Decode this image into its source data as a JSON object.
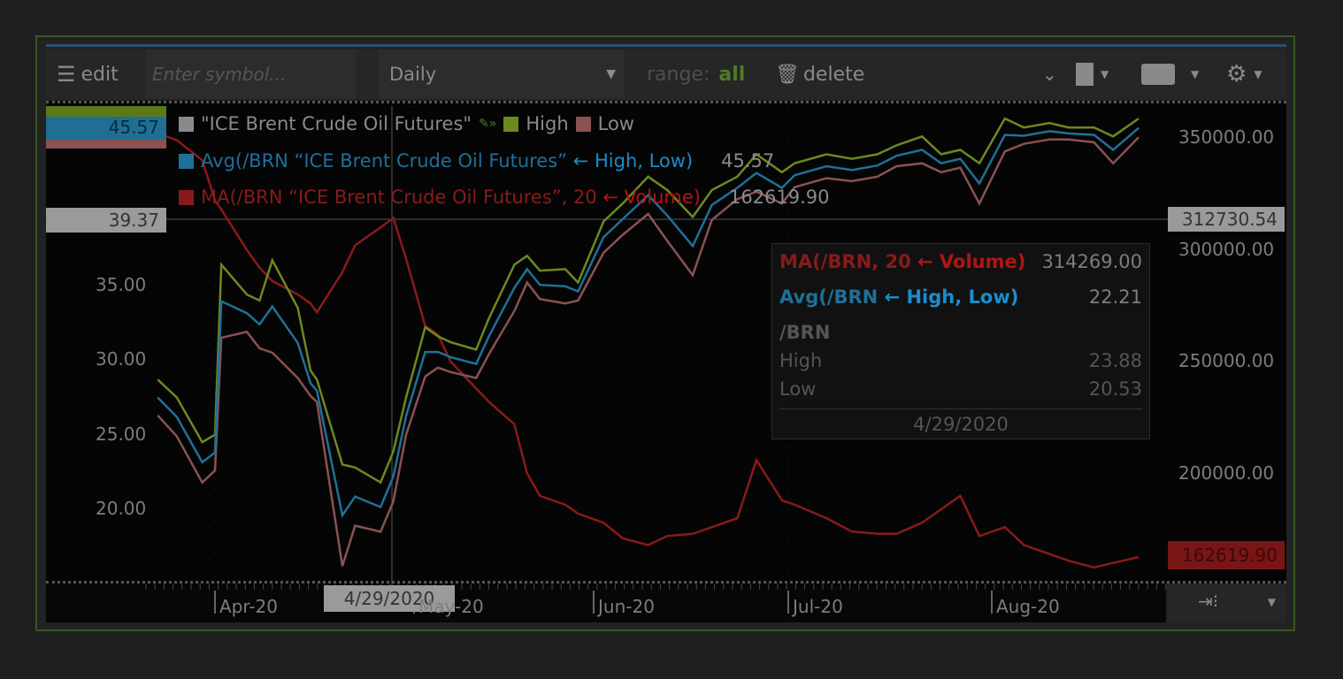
{
  "toolbar": {
    "edit_label": "edit",
    "symbol_placeholder": "Enter symbol...",
    "aggregation": "Daily",
    "range_label": "range:",
    "range_value": "all",
    "delete_label": "delete",
    "icons": [
      "menu-icon",
      "chevron-down-icon",
      "save-file-icon",
      "printer-icon",
      "gear-icon",
      "trash-icon"
    ]
  },
  "legend": {
    "symbol_title": "\"ICE Brent Crude Oil Futures\"",
    "high_label": "High",
    "low_label": "Low",
    "avg_label": "Avg(/BRN “ICE Brent Crude Oil Futures” ",
    "avg_arrow": "← High, Low)",
    "avg_value": "45.57",
    "ma_label": "MA(/BRN “ICE Brent Crude Oil Futures”, 20 ",
    "ma_arrow": "← Volume)",
    "ma_value": "162619.90"
  },
  "badges": {
    "price_last": "45.57",
    "price_cursor": "39.37",
    "volume_cursor": "312730.54",
    "volume_last": "162619.90",
    "date_cursor": "4/29/2020"
  },
  "tooltip": {
    "ma_label": "MA(/BRN, 20 ",
    "ma_arrow": "← Volume)",
    "ma_value": "314269.00",
    "avg_label": "Avg(/BRN ",
    "avg_arrow": "← High, Low)",
    "avg_value": "22.21",
    "symbol": "/BRN",
    "high_label": "High",
    "high_value": "23.88",
    "low_label": "Low",
    "low_value": "20.53",
    "date": "4/29/2020"
  },
  "colors": {
    "high": "#6b8a1e",
    "low": "#8a5252",
    "avg": "#1f7099",
    "ma": "#8a1a1a",
    "frame": "#3a5624"
  },
  "chart_data": {
    "type": "line",
    "left_axis": {
      "ticks": [
        "35.00",
        "30.00",
        "25.00",
        "20.00"
      ],
      "range": [
        15,
        47
      ]
    },
    "right_axis": {
      "ticks": [
        "350000.00",
        "300000.00",
        "250000.00",
        "200000.00"
      ]
    },
    "x_ticks": [
      "Apr-20",
      "May-20",
      "Jun-20",
      "Jul-20",
      "Aug-20"
    ],
    "x": [
      "2020-03-23",
      "2020-03-26",
      "2020-03-30",
      "2020-04-01",
      "2020-04-02",
      "2020-04-06",
      "2020-04-08",
      "2020-04-10",
      "2020-04-14",
      "2020-04-16",
      "2020-04-17",
      "2020-04-21",
      "2020-04-23",
      "2020-04-27",
      "2020-04-29",
      "2020-05-01",
      "2020-05-04",
      "2020-05-06",
      "2020-05-08",
      "2020-05-12",
      "2020-05-14",
      "2020-05-18",
      "2020-05-20",
      "2020-05-22",
      "2020-05-26",
      "2020-05-28",
      "2020-06-01",
      "2020-06-04",
      "2020-06-08",
      "2020-06-11",
      "2020-06-15",
      "2020-06-18",
      "2020-06-22",
      "2020-06-25",
      "2020-06-29",
      "2020-07-01",
      "2020-07-06",
      "2020-07-10",
      "2020-07-14",
      "2020-07-17",
      "2020-07-21",
      "2020-07-24",
      "2020-07-27",
      "2020-07-30",
      "2020-08-03",
      "2020-08-06",
      "2020-08-10",
      "2020-08-13",
      "2020-08-17",
      "2020-08-20",
      "2020-08-24"
    ],
    "series": [
      {
        "name": "High",
        "axis": "left",
        "values": [
          28.7,
          27.5,
          24.5,
          25.0,
          36.4,
          34.4,
          34.0,
          36.7,
          33.5,
          29.3,
          28.7,
          23.0,
          22.8,
          21.8,
          23.88,
          27.5,
          32.2,
          31.6,
          31.2,
          30.7,
          32.8,
          36.4,
          37.0,
          36.0,
          36.1,
          35.2,
          39.3,
          40.5,
          42.3,
          41.4,
          39.6,
          41.4,
          42.3,
          43.8,
          42.6,
          43.2,
          43.8,
          43.5,
          43.8,
          44.4,
          45.0,
          43.8,
          44.1,
          43.2,
          46.2,
          45.6,
          45.9,
          45.6,
          45.6,
          45.0,
          46.2
        ]
      },
      {
        "name": "Low",
        "axis": "left",
        "values": [
          26.3,
          24.9,
          21.8,
          22.6,
          31.5,
          31.9,
          30.8,
          30.5,
          28.8,
          27.6,
          27.2,
          16.2,
          18.9,
          18.5,
          20.53,
          25.0,
          28.9,
          29.5,
          29.2,
          28.8,
          30.4,
          33.3,
          35.2,
          34.1,
          33.8,
          34.0,
          37.2,
          38.4,
          39.8,
          38.0,
          35.7,
          39.4,
          40.8,
          41.3,
          40.5,
          41.6,
          42.2,
          42.0,
          42.3,
          43.0,
          43.2,
          42.6,
          42.9,
          40.5,
          44.0,
          44.5,
          44.8,
          44.8,
          44.6,
          43.2,
          44.94
        ]
      },
      {
        "name": "Avg(/BRN “ICE Brent Crude Oil Futures” ← High, Low)",
        "axis": "left",
        "derived": "average of High and Low"
      },
      {
        "name": "MA(/BRN “ICE Brent Crude Oil Futures”, 20 ← Volume)",
        "axis": "right",
        "values": [
          352000,
          349000,
          340000,
          322000,
          318000,
          300000,
          292000,
          286000,
          280000,
          276000,
          272000,
          290000,
          302000,
          310000,
          314269,
          296000,
          266000,
          262000,
          250000,
          238000,
          232000,
          222000,
          200000,
          190000,
          186000,
          182000,
          178000,
          171000,
          168000,
          172000,
          173000,
          176000,
          180000,
          206000,
          188000,
          186000,
          180000,
          174000,
          173000,
          173000,
          178000,
          184000,
          190000,
          172000,
          176000,
          168000,
          164000,
          161000,
          158000,
          160000,
          162619.9
        ]
      }
    ],
    "crosshair": {
      "date": "4/29/2020",
      "price": 39.37,
      "volume": 312730.54
    },
    "grid": true
  }
}
